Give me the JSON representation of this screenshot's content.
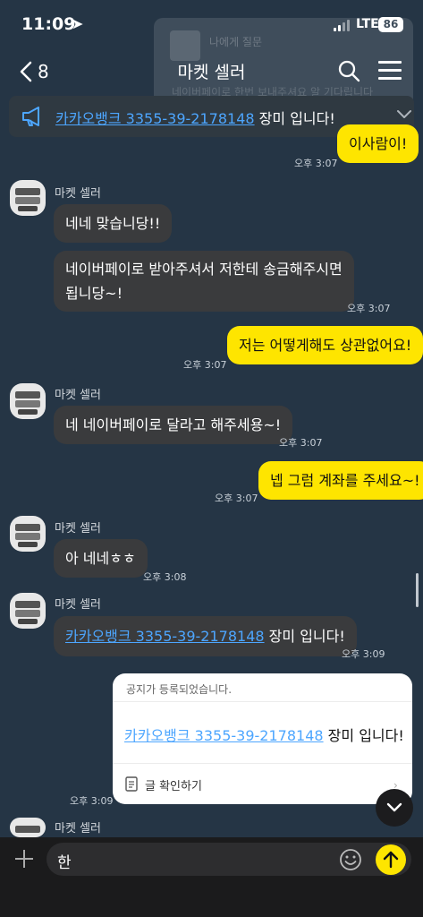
{
  "status": {
    "time": "11:09",
    "network": "LTE",
    "battery": "86"
  },
  "header": {
    "back_count": "8",
    "title": "마켓 셀러"
  },
  "ghost": {
    "title": "나에게 질문",
    "body": "네이버페이로 한번 보내주셔요 알 기다립니다"
  },
  "pinned": {
    "account": "카카오뱅크 3355-39-2178148",
    "suffix": " 장미 입니다!"
  },
  "messages": {
    "m0_text": "이사람이!",
    "m0_time": "오후 3:07",
    "s1": "마켓 셀러",
    "m1_text": "네네 맞습니당!!",
    "m2_line1": "네이버페이로 받아주셔서 저한테 송금해주시면",
    "m2_line2": "됩니당~!",
    "m2_time": "오후 3:07",
    "m3_text": "저는 어떻게해도 상관없어요!",
    "m3_time": "오후 3:07",
    "s2": "마켓 셀러",
    "m4_text": "네 네이버페이로 달라고 해주세용~!",
    "m4_time": "오후 3:07",
    "m5_text": "넵 그럼 계좌를 주세요~!",
    "m5_time": "오후 3:07",
    "s3": "마켓 셀러",
    "m6_text": "아 네네ㅎㅎ",
    "m6_time": "오후 3:08",
    "s4": "마켓 셀러",
    "m7_account": "카카오뱅크 3355-39-2178148",
    "m7_suffix": " 장미 입니다!",
    "m7_time": "오후 3:09",
    "s5": "마켓 셀러"
  },
  "notice": {
    "header": "공지가 등록되었습니다.",
    "account": "카카오뱅크 3355-39-2178148",
    "suffix": " 장미 입니다!",
    "footer": "글 확인하기",
    "time": "오후 3:09"
  },
  "input": {
    "text": "한"
  },
  "colors": {
    "background": "#253545",
    "my_bubble": "#fee500",
    "their_bubble": "#3a3b3d",
    "link": "#4da6ff"
  }
}
